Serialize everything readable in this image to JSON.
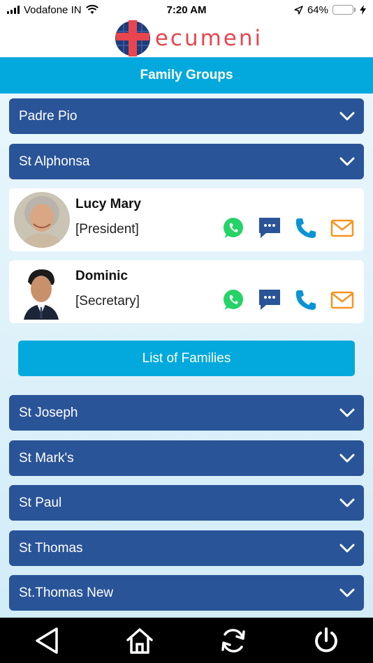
{
  "status_bar": {
    "carrier": "Vodafone IN",
    "time": "7:20 AM",
    "battery": "64%",
    "battery_level": 0.64
  },
  "app": {
    "logo_text": "ecumeni"
  },
  "header": {
    "title": "Family Groups"
  },
  "groups_top": [
    {
      "label": "Padre Pio"
    },
    {
      "label": "St Alphonsa"
    }
  ],
  "members": [
    {
      "name": "Lucy Mary",
      "role": "[President]"
    },
    {
      "name": "Dominic",
      "role": "[Secretary]"
    }
  ],
  "list_button": {
    "label": "List of Families"
  },
  "groups_bottom": [
    {
      "label": "St Joseph"
    },
    {
      "label": "St Mark's"
    },
    {
      "label": "St Paul"
    },
    {
      "label": "St Thomas"
    },
    {
      "label": "St.Thomas New"
    }
  ],
  "colors": {
    "accent": "#03a9dc",
    "group_bg": "#2a5498",
    "brand_red": "#e8454e",
    "whatsapp": "#25d366",
    "message": "#2a5498",
    "phone": "#0a93d6",
    "email": "#f7941d"
  },
  "icons": {
    "actions": [
      "whatsapp-icon",
      "message-icon",
      "phone-icon",
      "email-icon"
    ],
    "nav": [
      "back-icon",
      "home-icon",
      "refresh-icon",
      "power-icon"
    ]
  }
}
